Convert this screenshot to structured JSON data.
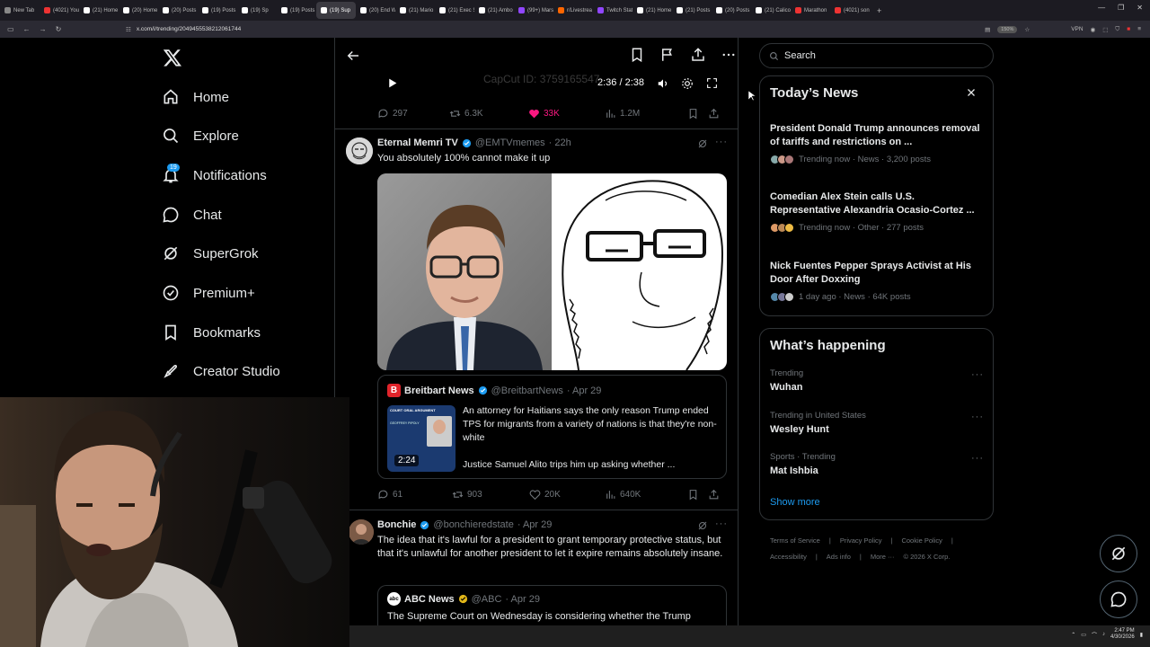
{
  "browser": {
    "tabs": [
      {
        "label": "New Tab",
        "fav": ""
      },
      {
        "label": "(4021) You",
        "fav": "red"
      },
      {
        "label": "(21) Home",
        "fav": "x"
      },
      {
        "label": "(20) Home",
        "fav": "x"
      },
      {
        "label": "(20) Posts",
        "fav": "x"
      },
      {
        "label": "(19) Posts",
        "fav": "x"
      },
      {
        "label": "(19) Sp",
        "fav": "x"
      },
      {
        "label": "(19) Posts",
        "fav": "x"
      },
      {
        "label": "(19) Sup",
        "fav": "x",
        "active": true
      },
      {
        "label": "(20) End W",
        "fav": "x"
      },
      {
        "label": "(21) Mario",
        "fav": "x"
      },
      {
        "label": "(21) Exec S",
        "fav": "x"
      },
      {
        "label": "(21) Ambo",
        "fav": "x"
      },
      {
        "label": "(99+) Mars",
        "fav": "twitch"
      },
      {
        "label": "r/Livestrea",
        "fav": "orange"
      },
      {
        "label": "Twitch Stat",
        "fav": "twitch"
      },
      {
        "label": "(21) Home",
        "fav": "x"
      },
      {
        "label": "(21) Posts",
        "fav": "x"
      },
      {
        "label": "(20) Posts",
        "fav": "x"
      },
      {
        "label": "(21) Calico",
        "fav": "x"
      },
      {
        "label": "Marathon",
        "fav": "red"
      },
      {
        "label": "(4021) son",
        "fav": "red"
      }
    ],
    "url": "x.com/i/trending/2049455538212061744",
    "zoom": "150%",
    "vpn": "VPN"
  },
  "nav": {
    "home": "Home",
    "explore": "Explore",
    "notifications": "Notifications",
    "notifications_badge": "19",
    "chat": "Chat",
    "supergrok": "SuperGrok",
    "premium": "Premium+",
    "bookmarks": "Bookmarks",
    "creator_studio": "Creator Studio"
  },
  "video": {
    "watermark": "CapCut ID: 3759165547",
    "time": "2:36 / 2:38"
  },
  "post0_stats": {
    "replies": "297",
    "reposts": "6.3K",
    "likes": "33K",
    "views": "1.2M"
  },
  "post1": {
    "name": "Eternal Memri TV",
    "handle": "@EMTVmemes",
    "time": "· 22h",
    "text": "You absolutely 100% cannot make it up",
    "quote": {
      "name": "Breitbart News",
      "handle": "@BreitbartNews",
      "time": "· Apr 29",
      "text": "An attorney for Haitians says the only reason Trump ended TPS for migrants from a variety of nations is that they're non-white",
      "subtext": "Justice Samuel Alito trips him up asking whether ...",
      "duration": "2:24",
      "thumb_label": "COURT ORAL ARGUMENT",
      "thumb_name": "GEOFFREY PIPOLY"
    },
    "stats": {
      "replies": "61",
      "reposts": "903",
      "likes": "20K",
      "views": "640K"
    }
  },
  "post2": {
    "name": "Bonchie",
    "handle": "@bonchieredstate",
    "time": "· Apr 29",
    "text": "The idea that it's lawful for a president to grant temporary protective status, but that it's unlawful for another president to let it expire remains absolutely insane.",
    "quote": {
      "name": "ABC News",
      "handle": "@ABC",
      "time": "· Apr 29",
      "text": "The Supreme Court on Wednesday is considering whether the Trump"
    }
  },
  "search": {
    "placeholder": "Search"
  },
  "todays_news": {
    "title": "Today’s News",
    "items": [
      {
        "title": "President Donald Trump announces removal of tariffs and restrictions on ...",
        "meta": "Trending now · News · 3,200 posts"
      },
      {
        "title": "Comedian Alex Stein calls U.S. Representative Alexandria Ocasio-Cortez ...",
        "meta": "Trending now · Other · 277 posts"
      },
      {
        "title": "Nick Fuentes Pepper Sprays Activist at His Door After Doxxing",
        "meta": "1 day ago · News · 64K posts"
      }
    ]
  },
  "whats_happening": {
    "title": "What’s happening",
    "items": [
      {
        "meta": "Trending",
        "name": "Wuhan"
      },
      {
        "meta": "Trending in United States",
        "name": "Wesley Hunt"
      },
      {
        "meta": "Sports · Trending",
        "name": "Mat Ishbia"
      }
    ],
    "show_more": "Show more"
  },
  "footer": {
    "terms": "Terms of Service",
    "privacy": "Privacy Policy",
    "cookie": "Cookie Policy",
    "accessibility": "Accessibility",
    "ads": "Ads info",
    "more": "More ···",
    "copyright": "© 2026 X Corp."
  },
  "taskbar": {
    "time": "2:47 PM",
    "date": "4/30/2026"
  },
  "colors": {
    "accent": "#1d9bf0",
    "like": "#f91880",
    "bg": "#000000",
    "border": "#2f3336",
    "muted": "#71767b"
  }
}
